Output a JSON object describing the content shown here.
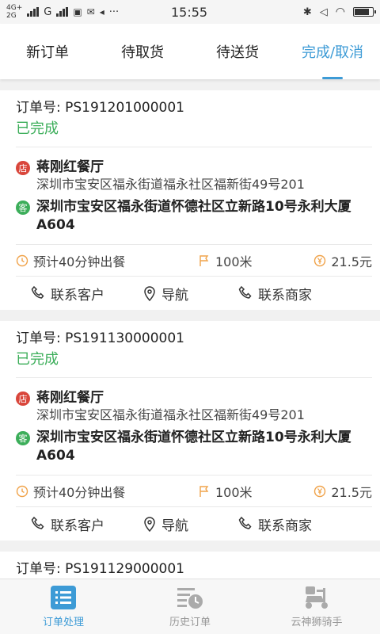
{
  "status_bar": {
    "net1": "4G+",
    "net2": "2G",
    "carrier": "G",
    "time": "15:55"
  },
  "tabs": [
    {
      "label": "新订单",
      "active": false
    },
    {
      "label": "待取货",
      "active": false
    },
    {
      "label": "待送货",
      "active": false
    },
    {
      "label": "完成/取消",
      "active": true
    }
  ],
  "order_no_prefix": "订单号: ",
  "badges": {
    "shop": "店",
    "customer": "客"
  },
  "orders": [
    {
      "order_no": "PS191201000001",
      "status": "已完成",
      "shop_name": "蒋刚红餐厅",
      "shop_address": "深圳市宝安区福永街道福永社区福新街49号201",
      "customer_address": "深圳市宝安区福永街道怀德社区立新路10号永利大厦A604",
      "eta": "预计40分钟出餐",
      "distance": "100米",
      "fee": "21.5元"
    },
    {
      "order_no": "PS191130000001",
      "status": "已完成",
      "shop_name": "蒋刚红餐厅",
      "shop_address": "深圳市宝安区福永街道福永社区福新街49号201",
      "customer_address": "深圳市宝安区福永街道怀德社区立新路10号永利大厦A604",
      "eta": "预计40分钟出餐",
      "distance": "100米",
      "fee": "21.5元"
    },
    {
      "order_no": "PS191129000001"
    }
  ],
  "actions": {
    "contact_customer": "联系客户",
    "navigate": "导航",
    "contact_merchant": "联系商家"
  },
  "bottom_nav": [
    {
      "label": "订单处理",
      "active": true
    },
    {
      "label": "历史订单",
      "active": false
    },
    {
      "label": "云神狮骑手",
      "active": false
    }
  ],
  "colors": {
    "accent": "#3d9bd6",
    "done_green": "#3cae5a",
    "shop_red": "#d9463b",
    "info_orange": "#f0a34a"
  }
}
